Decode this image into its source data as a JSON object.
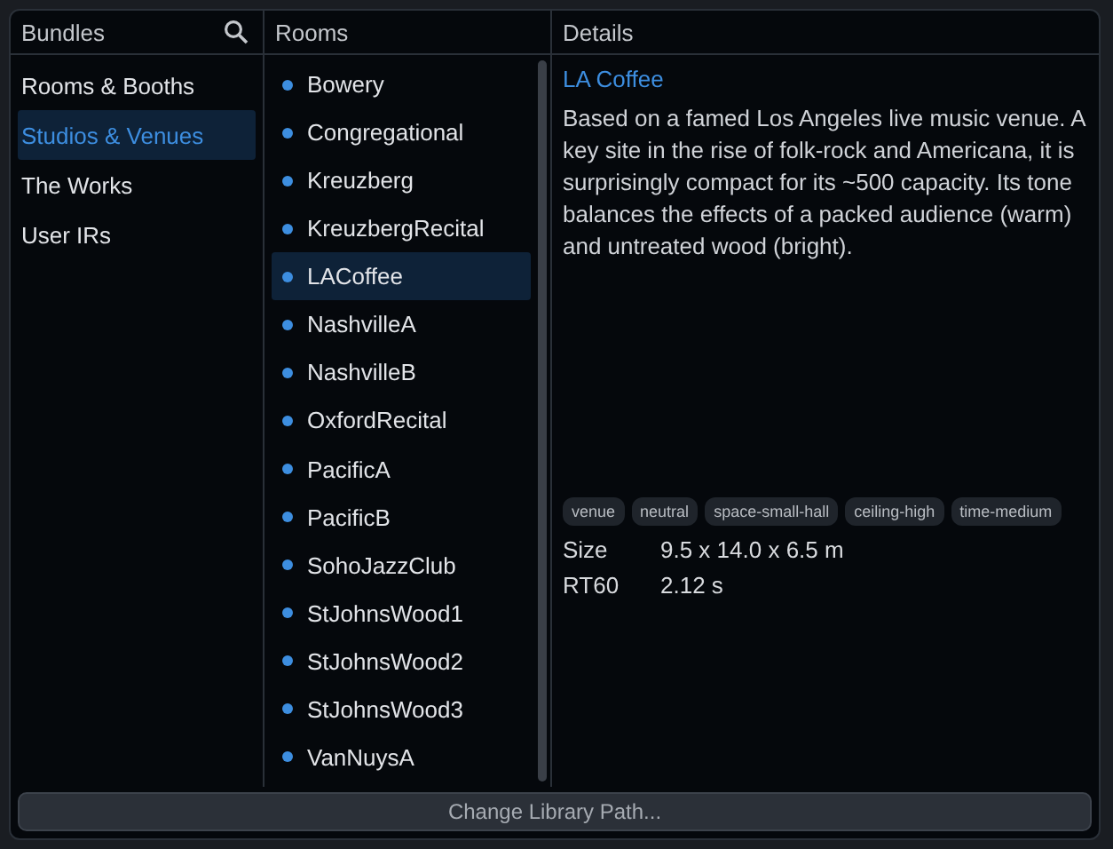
{
  "bundles": {
    "title": "Bundles",
    "items": [
      {
        "label": "Rooms & Booths",
        "selected": false
      },
      {
        "label": "Studios & Venues",
        "selected": true
      },
      {
        "label": "The Works",
        "selected": false
      },
      {
        "label": "User IRs",
        "selected": false
      }
    ]
  },
  "rooms": {
    "title": "Rooms",
    "items": [
      {
        "label": "Bowery",
        "selected": false
      },
      {
        "label": "Congregational",
        "selected": false
      },
      {
        "label": "Kreuzberg",
        "selected": false
      },
      {
        "label": "KreuzbergRecital",
        "selected": false
      },
      {
        "label": "LACoffee",
        "selected": true
      },
      {
        "label": "NashvilleA",
        "selected": false
      },
      {
        "label": "NashvilleB",
        "selected": false
      },
      {
        "label": "OxfordRecital",
        "selected": false
      },
      {
        "label": "PacificA",
        "selected": false
      },
      {
        "label": "PacificB",
        "selected": false
      },
      {
        "label": "SohoJazzClub",
        "selected": false
      },
      {
        "label": "StJohnsWood1",
        "selected": false
      },
      {
        "label": "StJohnsWood2",
        "selected": false
      },
      {
        "label": "StJohnsWood3",
        "selected": false
      },
      {
        "label": "VanNuysA",
        "selected": false
      }
    ]
  },
  "details": {
    "title": "Details",
    "name": "LA Coffee",
    "description": "Based on a famed Los Angeles live music venue. A key site in the rise of folk-rock and Americana, it is surprisingly compact for its ~500 capacity. Its tone balances the effects of a packed audience (warm) and untreated wood (bright).",
    "tags": [
      "venue",
      "neutral",
      "space-small-hall",
      "ceiling-high",
      "time-medium"
    ],
    "properties": [
      {
        "label": "Size",
        "value": "9.5 x 14.0 x 6.5 m"
      },
      {
        "label": "RT60",
        "value": "2.12 s"
      }
    ]
  },
  "button": "Change Library Path..."
}
